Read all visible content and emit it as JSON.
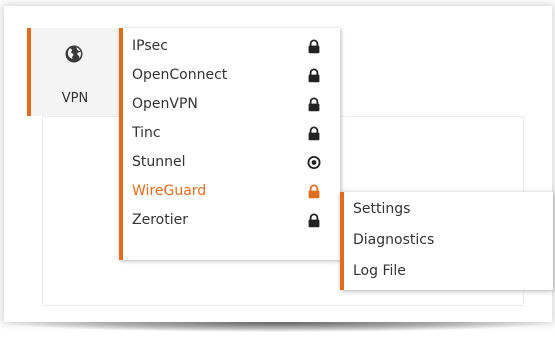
{
  "vpn_tile": {
    "label": "VPN",
    "icon": "globe-icon"
  },
  "menu": {
    "items": [
      {
        "label": "IPsec",
        "icon": "lock-icon",
        "active": false
      },
      {
        "label": "OpenConnect",
        "icon": "lock-icon",
        "active": false
      },
      {
        "label": "OpenVPN",
        "icon": "lock-icon",
        "active": false
      },
      {
        "label": "Tinc",
        "icon": "lock-icon",
        "active": false
      },
      {
        "label": "Stunnel",
        "icon": "circle-dot-icon",
        "active": false
      },
      {
        "label": "WireGuard",
        "icon": "lock-icon",
        "active": true
      },
      {
        "label": "Zerotier",
        "icon": "lock-icon",
        "active": false
      }
    ]
  },
  "submenu": {
    "items": [
      {
        "label": "Settings"
      },
      {
        "label": "Diagnostics"
      },
      {
        "label": "Log File"
      }
    ]
  },
  "colors": {
    "accent": "#e06d1c",
    "text": "#333333",
    "icon": "#222222",
    "tile_background": "#f4f4f4"
  }
}
